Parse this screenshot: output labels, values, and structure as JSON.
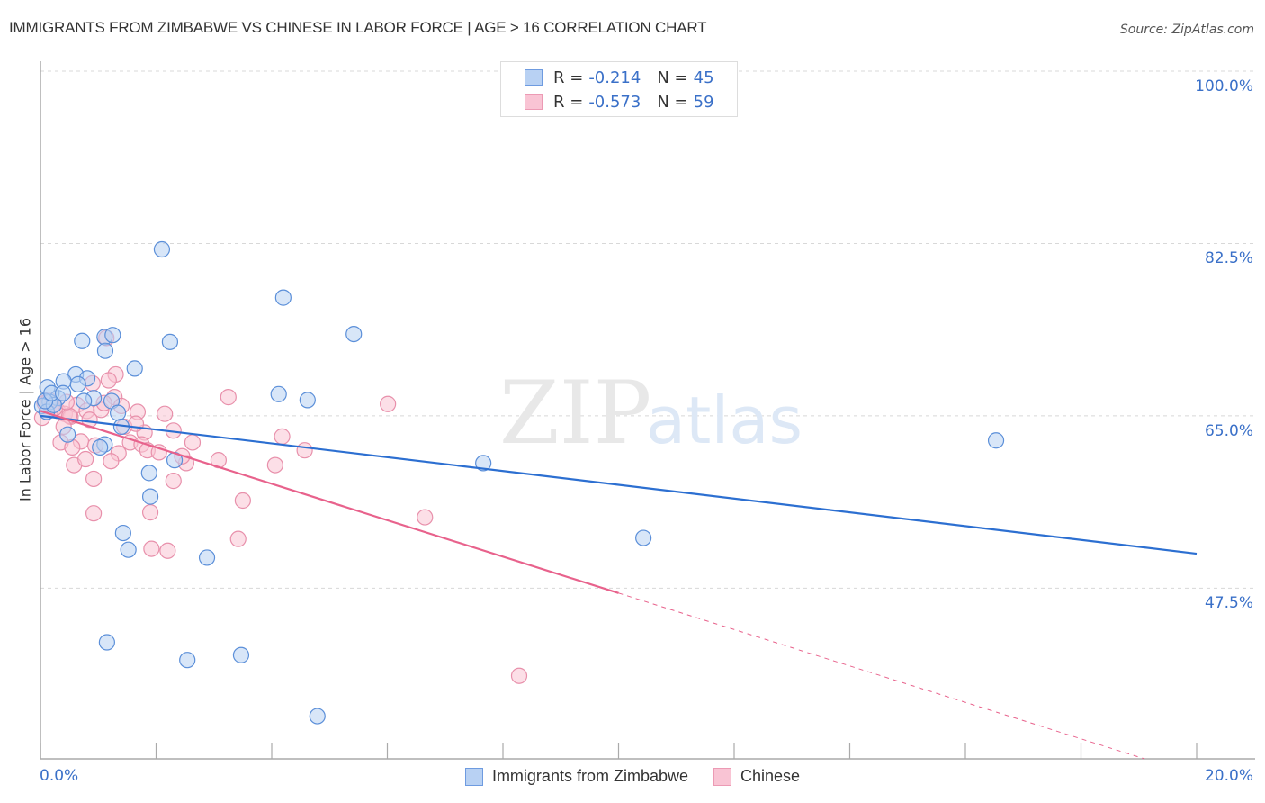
{
  "header": {
    "title": "IMMIGRANTS FROM ZIMBABWE VS CHINESE IN LABOR FORCE | AGE > 16 CORRELATION CHART",
    "source": "Source: ZipAtlas.com"
  },
  "watermark": {
    "zip": "ZIP",
    "atlas": "atlas"
  },
  "legend": {
    "rows": [
      {
        "r_label": "R =",
        "r_value": "-0.214",
        "n_label": "N =",
        "n_value": "45"
      },
      {
        "r_label": "R =",
        "r_value": "-0.573",
        "n_label": "N =",
        "n_value": "59"
      }
    ]
  },
  "colors": {
    "series1_fill": "#b8d1f3",
    "series1_stroke": "#5b8fd9",
    "series1_line": "#2c6fd1",
    "series2_fill": "#f9c4d4",
    "series2_stroke": "#e890ab",
    "series2_line": "#e8628c",
    "tick_label": "#3a70c8"
  },
  "chart_data": {
    "type": "scatter",
    "title": "IMMIGRANTS FROM ZIMBABWE VS CHINESE IN LABOR FORCE | AGE > 16 CORRELATION CHART",
    "xlabel": "",
    "ylabel": "In Labor Force | Age > 16",
    "xlim": [
      0,
      20
    ],
    "ylim": [
      30.2,
      101.8
    ],
    "x_tick_labels": [
      "0.0%",
      "20.0%"
    ],
    "x_minor_ticks": [
      0,
      2,
      4,
      6,
      8,
      10,
      12,
      14,
      16,
      18,
      20
    ],
    "y_ticks": [
      100.0,
      82.5,
      65.0,
      47.5
    ],
    "y_tick_labels": [
      "100.0%",
      "82.5%",
      "65.0%",
      "47.5%"
    ],
    "grid": true,
    "legend_position": "top-center",
    "series": [
      {
        "name": "Immigrants from Zimbabwe",
        "R": -0.214,
        "N": 45,
        "trend": {
          "x": [
            0,
            20
          ],
          "y": [
            65.0,
            51.0
          ],
          "dashed_from": null
        },
        "points": [
          [
            2.1,
            81.9
          ],
          [
            4.2,
            77.0
          ],
          [
            5.42,
            73.3
          ],
          [
            0.72,
            72.6
          ],
          [
            1.11,
            73.0
          ],
          [
            2.24,
            72.5
          ],
          [
            1.12,
            71.6
          ],
          [
            1.63,
            69.8
          ],
          [
            0.61,
            69.2
          ],
          [
            0.81,
            68.8
          ],
          [
            0.4,
            68.5
          ],
          [
            0.12,
            67.9
          ],
          [
            0.65,
            68.2
          ],
          [
            4.12,
            67.2
          ],
          [
            4.62,
            66.6
          ],
          [
            0.92,
            66.8
          ],
          [
            1.23,
            66.5
          ],
          [
            0.3,
            66.8
          ],
          [
            0.16,
            66.4
          ],
          [
            0.03,
            66.0
          ],
          [
            0.11,
            65.4
          ],
          [
            0.75,
            66.5
          ],
          [
            0.23,
            66.1
          ],
          [
            1.34,
            65.3
          ],
          [
            0.08,
            66.5
          ],
          [
            1.4,
            63.9
          ],
          [
            0.47,
            63.1
          ],
          [
            1.11,
            62.1
          ],
          [
            1.03,
            61.8
          ],
          [
            16.53,
            62.5
          ],
          [
            2.32,
            60.5
          ],
          [
            7.66,
            60.2
          ],
          [
            1.88,
            59.2
          ],
          [
            1.9,
            56.8
          ],
          [
            1.43,
            53.1
          ],
          [
            1.52,
            51.4
          ],
          [
            2.88,
            50.6
          ],
          [
            10.43,
            52.6
          ],
          [
            1.15,
            42.0
          ],
          [
            2.54,
            40.2
          ],
          [
            3.47,
            40.7
          ],
          [
            4.79,
            34.5
          ],
          [
            0.19,
            67.3
          ],
          [
            0.39,
            67.3
          ],
          [
            1.25,
            73.2
          ]
        ]
      },
      {
        "name": "Chinese",
        "R": -0.573,
        "N": 59,
        "trend": {
          "x": [
            0,
            20
          ],
          "y": [
            65.5,
            28.5
          ],
          "solid_until_x": 10.0
        },
        "points": [
          [
            1.14,
            72.9
          ],
          [
            1.3,
            69.2
          ],
          [
            1.18,
            68.6
          ],
          [
            0.9,
            68.3
          ],
          [
            1.28,
            66.9
          ],
          [
            3.25,
            66.9
          ],
          [
            6.01,
            66.2
          ],
          [
            0.07,
            66.3
          ],
          [
            0.18,
            65.9
          ],
          [
            0.3,
            65.5
          ],
          [
            0.42,
            65.2
          ],
          [
            0.52,
            64.9
          ],
          [
            0.63,
            66.1
          ],
          [
            0.8,
            65.5
          ],
          [
            1.05,
            65.6
          ],
          [
            1.4,
            66.0
          ],
          [
            1.68,
            65.4
          ],
          [
            2.15,
            65.2
          ],
          [
            0.03,
            64.8
          ],
          [
            0.5,
            65.0
          ],
          [
            0.85,
            64.6
          ],
          [
            1.45,
            63.9
          ],
          [
            1.8,
            63.3
          ],
          [
            2.3,
            63.5
          ],
          [
            4.18,
            62.9
          ],
          [
            0.35,
            62.3
          ],
          [
            0.7,
            62.4
          ],
          [
            1.55,
            62.3
          ],
          [
            1.75,
            62.1
          ],
          [
            2.63,
            62.3
          ],
          [
            0.55,
            61.8
          ],
          [
            0.95,
            62.0
          ],
          [
            1.35,
            61.2
          ],
          [
            1.85,
            61.5
          ],
          [
            2.05,
            61.3
          ],
          [
            4.57,
            61.5
          ],
          [
            0.58,
            60.0
          ],
          [
            0.78,
            60.6
          ],
          [
            1.22,
            60.4
          ],
          [
            2.52,
            60.2
          ],
          [
            3.08,
            60.5
          ],
          [
            4.06,
            60.0
          ],
          [
            0.92,
            58.6
          ],
          [
            2.3,
            58.4
          ],
          [
            3.5,
            56.4
          ],
          [
            0.92,
            55.1
          ],
          [
            1.9,
            55.2
          ],
          [
            6.65,
            54.7
          ],
          [
            3.42,
            52.5
          ],
          [
            1.92,
            51.5
          ],
          [
            2.2,
            51.3
          ],
          [
            8.28,
            38.6
          ],
          [
            0.25,
            65.8
          ],
          [
            0.45,
            66.4
          ],
          [
            0.15,
            66.6
          ],
          [
            1.65,
            64.2
          ],
          [
            2.45,
            60.9
          ],
          [
            1.1,
            66.3
          ],
          [
            0.4,
            63.9
          ]
        ]
      }
    ]
  },
  "bottom_legend": {
    "items": [
      {
        "label": "Immigrants from Zimbabwe"
      },
      {
        "label": "Chinese"
      }
    ]
  }
}
